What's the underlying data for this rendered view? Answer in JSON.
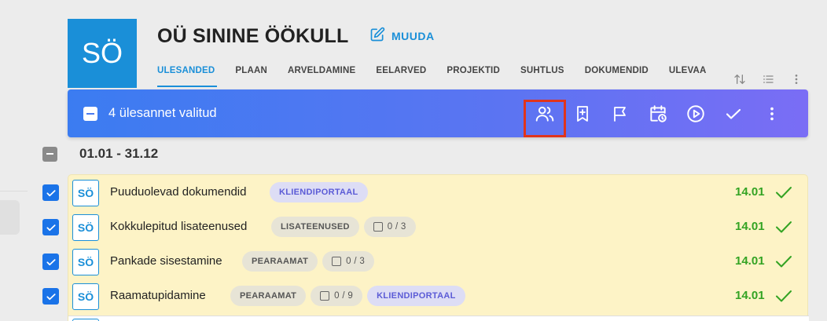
{
  "header": {
    "avatar_initials": "SÖ",
    "company_name": "OÜ SININE ÖÖKULL",
    "edit_label": "MUUDA",
    "tabs": [
      {
        "label": "ÜLESANDED",
        "active": true
      },
      {
        "label": "PLAAN"
      },
      {
        "label": "ARVELDAMINE"
      },
      {
        "label": "EELARVED"
      },
      {
        "label": "PROJEKTID"
      },
      {
        "label": "SUHTLUS"
      },
      {
        "label": "DOKUMENDID"
      },
      {
        "label": "ÜLEVAA"
      }
    ],
    "tool_icons": [
      "sort-icon",
      "list-view-icon",
      "more-vertical-icon"
    ]
  },
  "selection_bar": {
    "text": "4 ülesannet valitud",
    "actions": [
      "assign-users-icon",
      "add-bookmark-icon",
      "flag-icon",
      "schedule-icon",
      "start-icon",
      "complete-icon",
      "more-vertical-icon"
    ]
  },
  "group": {
    "label": "01.01 - 31.12"
  },
  "tasks": [
    {
      "initials": "SÖ",
      "name": "Puuduolevad dokumendid",
      "tag1": "",
      "counter": "",
      "tag2": "KLIENDIPORTAAL",
      "date": "14.01"
    },
    {
      "initials": "SÖ",
      "name": "Kokkulepitud lisateenused",
      "tag1": "LISATEENUSED",
      "counter": "0 / 3",
      "tag2": "",
      "date": "14.01"
    },
    {
      "initials": "SÖ",
      "name": "Pankade sisestamine",
      "tag1": "PEARAAMAT",
      "counter": "0 / 3",
      "tag2": "",
      "date": "14.01"
    },
    {
      "initials": "SÖ",
      "name": "Raamatupidamine",
      "tag1": "PEARAAMAT",
      "counter": "0 / 9",
      "tag2": "KLIENDIPORTAAL",
      "date": "14.01"
    }
  ],
  "colors": {
    "accent": "#1a8fd8",
    "selection_gradient_start": "#3b7cf1",
    "selection_gradient_end": "#7a6df5",
    "row_bg": "#fdf3c6",
    "done_green": "#33a323",
    "highlight_red": "#e0341c",
    "portal_chip": "#5b5bd6"
  }
}
